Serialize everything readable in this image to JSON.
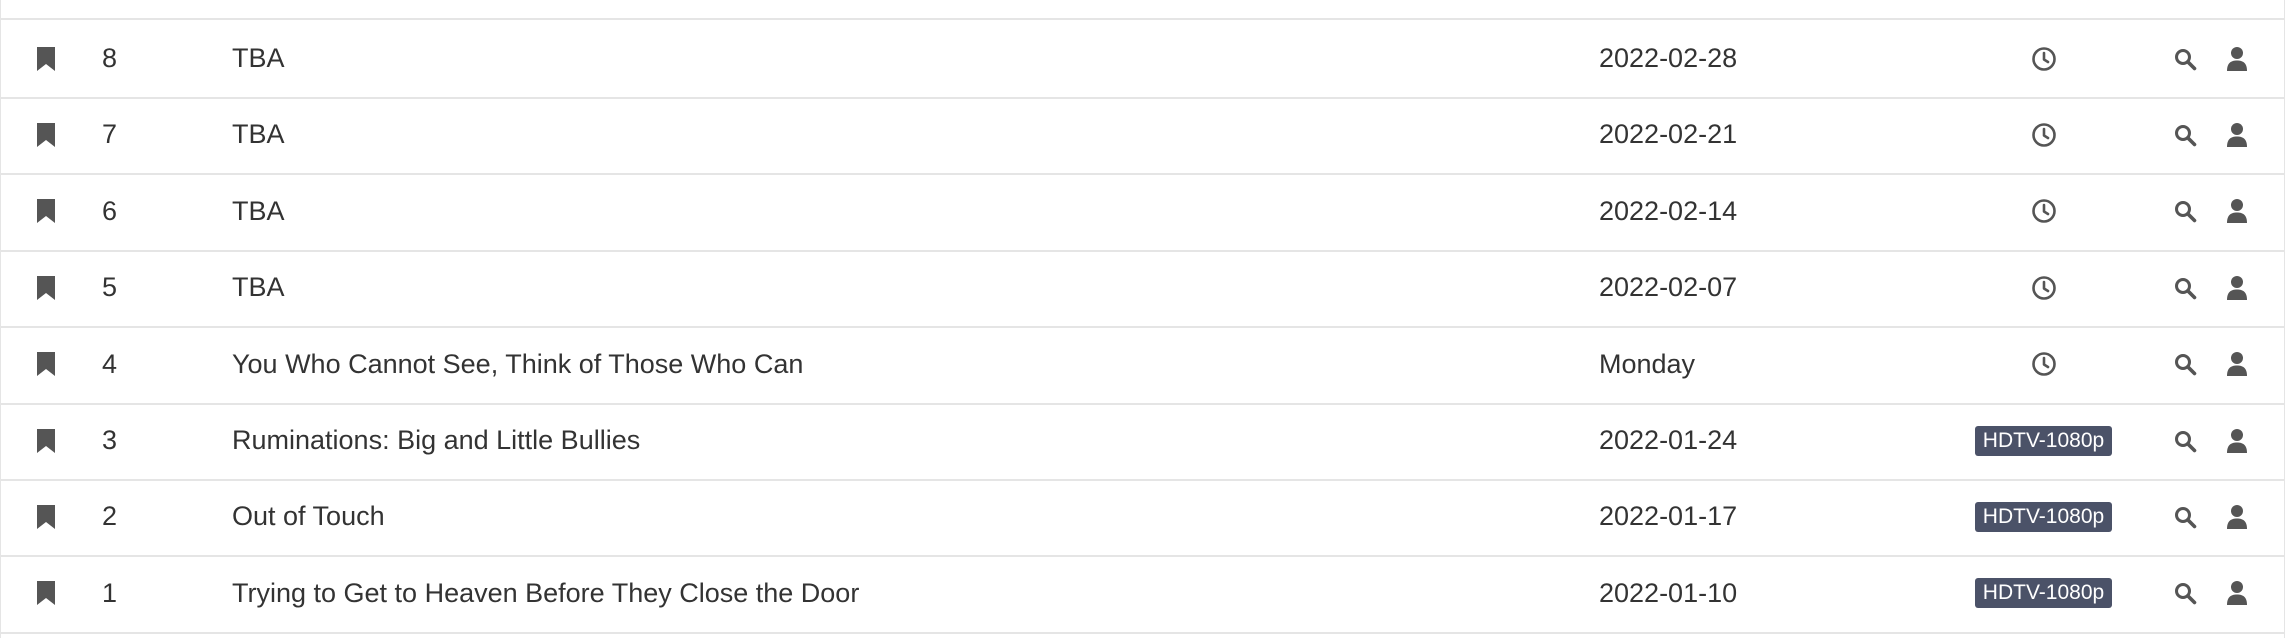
{
  "episodes": [
    {
      "number": "8",
      "title": "TBA",
      "air_date": "2022-02-28",
      "status": {
        "type": "icon",
        "icon": "clock-icon"
      }
    },
    {
      "number": "7",
      "title": "TBA",
      "air_date": "2022-02-21",
      "status": {
        "type": "icon",
        "icon": "clock-icon"
      }
    },
    {
      "number": "6",
      "title": "TBA",
      "air_date": "2022-02-14",
      "status": {
        "type": "icon",
        "icon": "clock-icon"
      }
    },
    {
      "number": "5",
      "title": "TBA",
      "air_date": "2022-02-07",
      "status": {
        "type": "icon",
        "icon": "clock-icon"
      }
    },
    {
      "number": "4",
      "title": "You Who Cannot See, Think of Those Who Can",
      "air_date": "Monday",
      "status": {
        "type": "icon",
        "icon": "clock-icon"
      }
    },
    {
      "number": "3",
      "title": "Ruminations: Big and Little Bullies",
      "air_date": "2022-01-24",
      "status": {
        "type": "badge",
        "label": "HDTV-1080p"
      }
    },
    {
      "number": "2",
      "title": "Out of Touch",
      "air_date": "2022-01-17",
      "status": {
        "type": "badge",
        "label": "HDTV-1080p"
      }
    },
    {
      "number": "1",
      "title": "Trying to Get to Heaven Before They Close the Door",
      "air_date": "2022-01-10",
      "status": {
        "type": "badge",
        "label": "HDTV-1080p"
      }
    }
  ],
  "row_icons": {
    "monitor": "bookmark-icon",
    "search": "search-icon",
    "manual": "user-icon"
  },
  "colors": {
    "icon": "#555555",
    "badge_bg": "#4b5268",
    "badge_text": "#ffffff",
    "divider": "#e5e5e5",
    "text": "#333333"
  }
}
